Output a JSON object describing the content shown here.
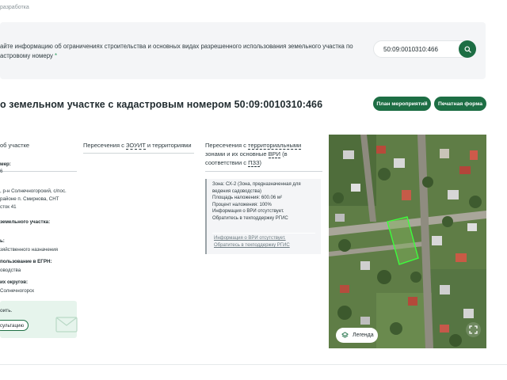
{
  "breadcrumb": {
    "text": "разработка"
  },
  "search": {
    "prompt_line1": "айте информацию об ограничениях строительства и основных видах разрешенного использования земельного участка по",
    "prompt_line2": "астровому номеру",
    "required_mark": "*",
    "value": "50:09:0010310:466"
  },
  "page": {
    "title": "о земельном участке с кадастровым номером 50:09:0010310:466"
  },
  "buttons": {
    "plan": "План мероприятий",
    "print": "Печатная форма"
  },
  "columns": {
    "col1_title": "об участке",
    "col2_pre": "Пересечения с ",
    "col2_link1": "ЗОУИТ",
    "col2_post": " и территориями",
    "col3_line1_pre": "Пересечения с ",
    "col3_line1_link": "территориальными",
    "col3_line2_pre": "зонами и их основные ",
    "col3_line2_link": "ВРИ",
    "col3_line2_post": " (в",
    "col3_line3_pre": "соответствии с ",
    "col3_line3_link": "ПЗЗ",
    "col3_line3_post": ")"
  },
  "parcel_info": {
    "line1": "мер:",
    "line2": "6",
    "line3": ", р-н Солнечногорский, с/пос.",
    "line4": "районе п. Смирнова, СНТ",
    "line5": "сток 41",
    "line6": "земельного участка:",
    "line7": "ь:",
    "line8": "зяйственного назначения",
    "line9": "пользование в ЕГРН:",
    "line10": "оводства",
    "line11": "их округов:",
    "line12": "Солнечногорск"
  },
  "promo": {
    "text": "оить.",
    "button": "сультацию"
  },
  "zone_card": {
    "l1": "Зона: СХ-2 (Зона, предназначенная для",
    "l2": "ведения садоводства)",
    "l3": "Площадь наложения: 600.06 м²",
    "l4": "Процент наложения: 100%",
    "l5": "Информация о ВРИ отсутствует.",
    "l6": "Обратитесь в техподдержку РГИС",
    "link1": "Информация о ВРИ отсутствует.",
    "link2": "Обратитесь в техподдержку РГИС"
  },
  "map": {
    "legend_label": "Легенда"
  },
  "colors": {
    "accent": "#1d6e44",
    "panel": "#f4f5f7",
    "promo": "#e6f4ec",
    "parcel": "#3cff3c"
  },
  "icons": {
    "search": "search-icon",
    "layers": "layers-icon",
    "expand": "expand-icon",
    "envelope": "envelope-icon"
  }
}
